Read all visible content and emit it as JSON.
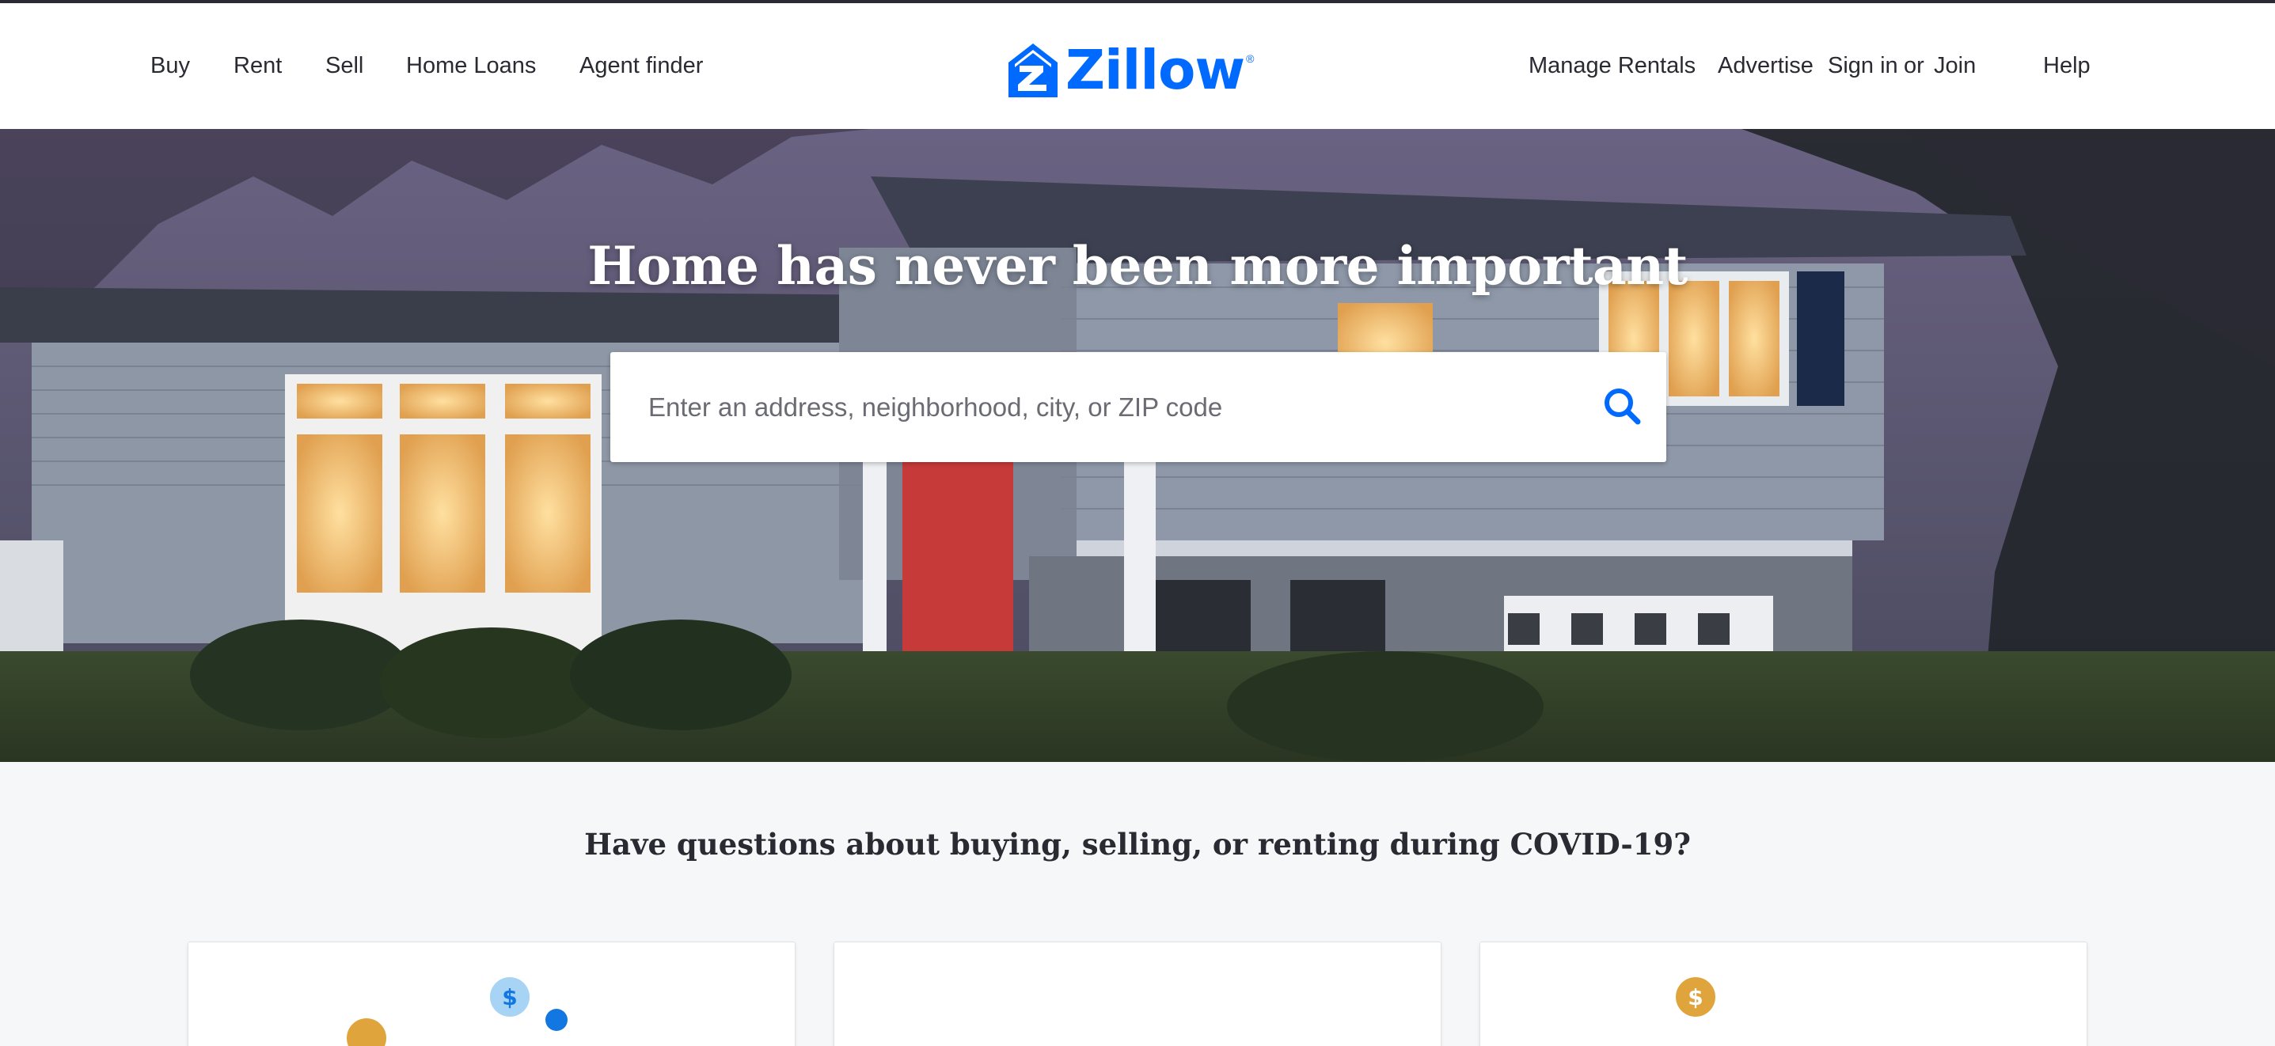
{
  "header": {
    "nav_left": [
      "Buy",
      "Rent",
      "Sell",
      "Home Loans",
      "Agent finder"
    ],
    "logo": {
      "text": "Zillow",
      "reg": "®"
    },
    "nav_right": {
      "manage_rentals": "Manage Rentals",
      "advertise": "Advertise",
      "sign_in": "Sign in",
      "or": "or",
      "join": "Join",
      "help": "Help"
    }
  },
  "hero": {
    "title": "Home has never been more important",
    "search": {
      "placeholder": "Enter an address, neighborhood, city, or ZIP code",
      "value": ""
    }
  },
  "covid": {
    "heading": "Have questions about buying, selling, or renting during COVID-19?",
    "cards": [
      {
        "icons": [
          "dollar-coin-icon"
        ]
      },
      {
        "icons": []
      },
      {
        "icons": [
          "dollar-coin-icon"
        ]
      }
    ],
    "icon_glyph": "$"
  },
  "colors": {
    "brand": "#006aff",
    "text": "#2a2a33",
    "card_coin_gold": "#e0a43c",
    "card_coin_blue": "#a7d3f5"
  }
}
